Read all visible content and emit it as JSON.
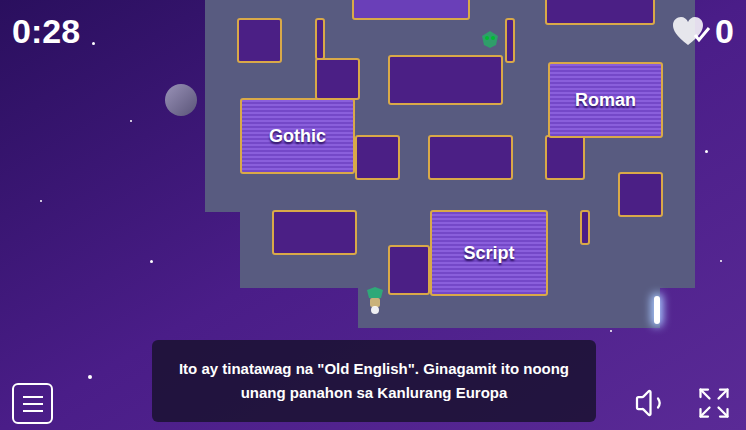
{
  "timer": "0:28",
  "score": {
    "correct": "0"
  },
  "answers": [
    {
      "label": "Gothic"
    },
    {
      "label": "Roman"
    },
    {
      "label": "Script"
    }
  ],
  "question": "Ito ay tinatawag na \"Old English\". Ginagamit ito noong unang panahon sa Kanlurang Europa"
}
